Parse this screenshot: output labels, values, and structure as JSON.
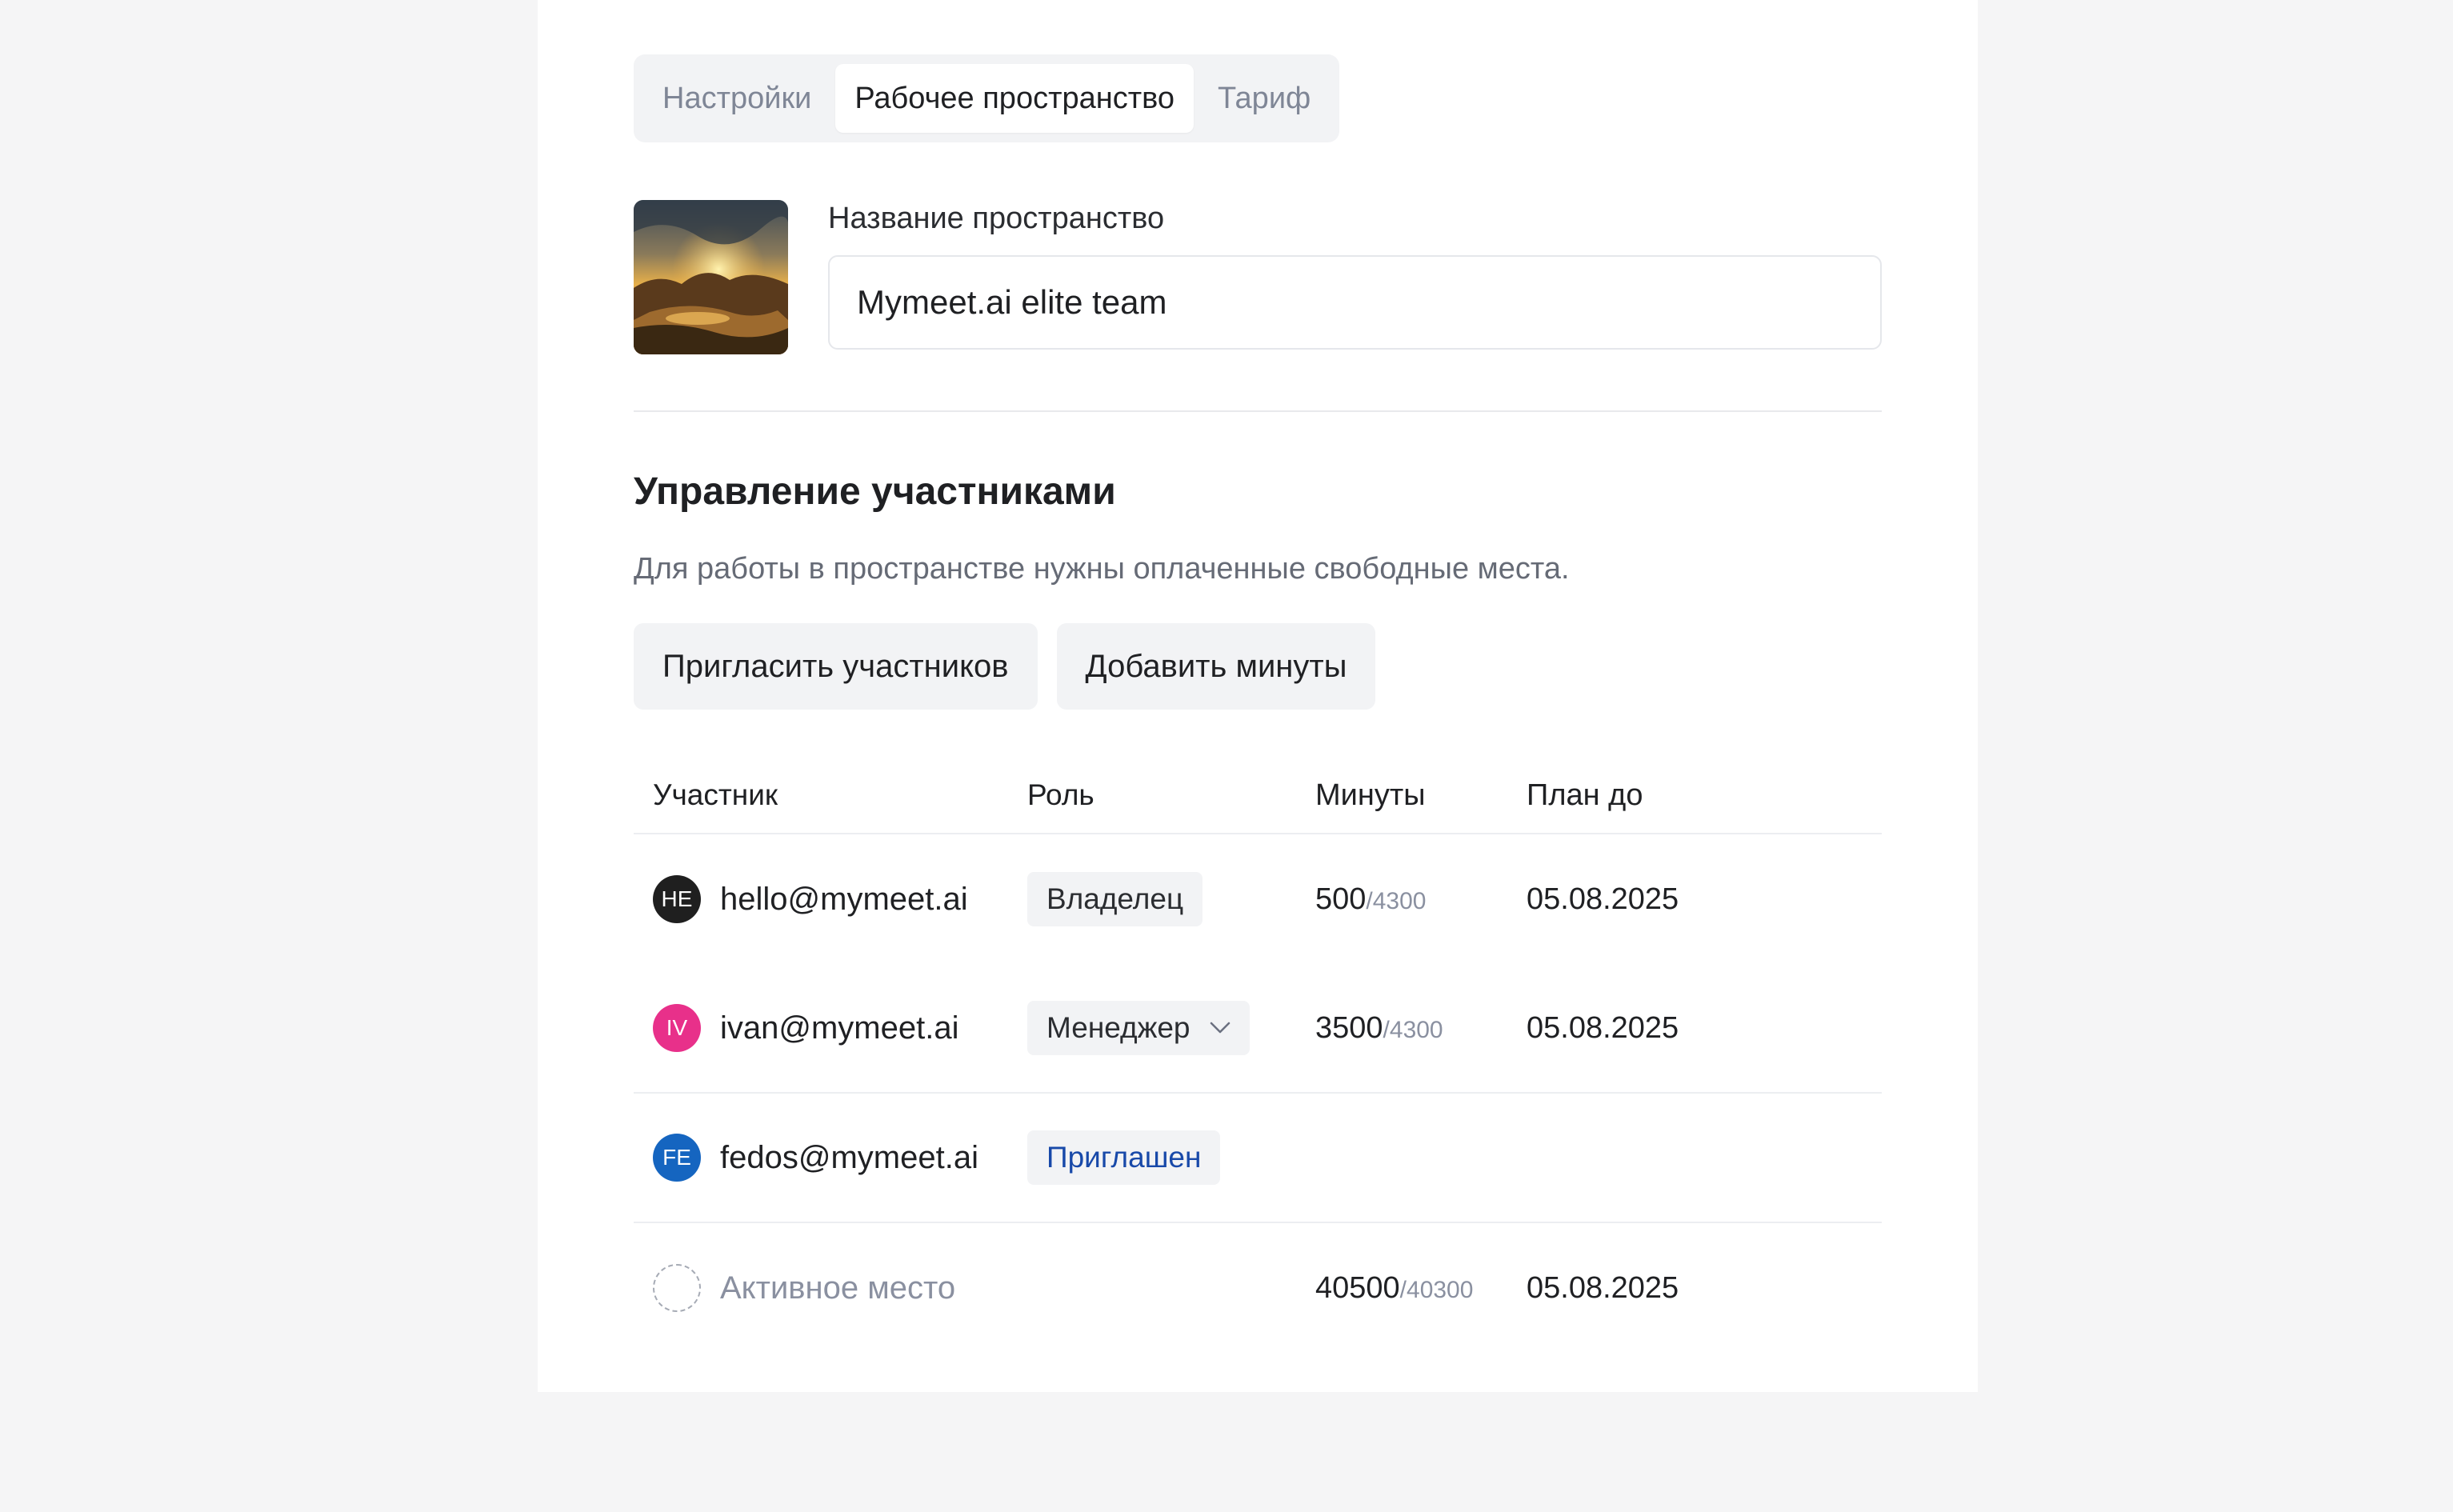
{
  "tabs": [
    {
      "label": "Настройки",
      "active": false
    },
    {
      "label": "Рабочее пространство",
      "active": true
    },
    {
      "label": "Тариф",
      "active": false
    }
  ],
  "workspace": {
    "name_label": "Название пространство",
    "name_value": "Mymeet.ai elite team",
    "avatar_icon": "landscape-painting-image"
  },
  "members": {
    "title": "Управление участниками",
    "description": "Для работы в пространстве нужны оплаченные свободные места.",
    "invite_button": "Пригласить участников",
    "add_minutes_button": "Добавить минуты",
    "columns": [
      "Участник",
      "Роль",
      "Минуты",
      "План до"
    ],
    "rows": [
      {
        "initials": "HE",
        "avatar_color": "#1f1f1f",
        "email": "hello@mymeet.ai",
        "role": "Владелец",
        "role_type": "static",
        "minutes_used": "500",
        "minutes_total": "/4300",
        "plan_until": "05.08.2025"
      },
      {
        "initials": "IV",
        "avatar_color": "#e8308a",
        "email": "ivan@mymeet.ai",
        "role": "Менеджер",
        "role_type": "select",
        "minutes_used": "3500",
        "minutes_total": "/4300",
        "plan_until": "05.08.2025"
      },
      {
        "initials": "FE",
        "avatar_color": "#1565c0",
        "email": "fedos@mymeet.ai",
        "role": "Приглашен",
        "role_type": "invited",
        "minutes_used": "",
        "minutes_total": "",
        "plan_until": ""
      },
      {
        "initials": "",
        "avatar_color": "",
        "email": "Активное место",
        "role": "",
        "role_type": "empty",
        "minutes_used": "40500",
        "minutes_total": "/40300",
        "plan_until": "05.08.2025"
      }
    ]
  }
}
